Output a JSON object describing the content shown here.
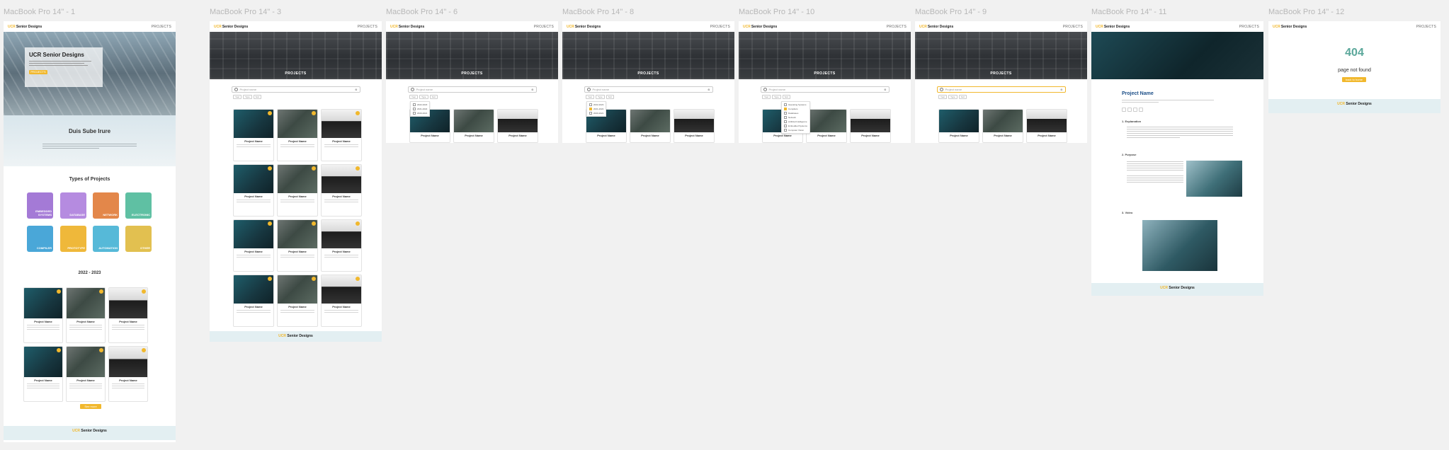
{
  "frames": [
    {
      "label": "MacBook Pro 14\" - 1"
    },
    {
      "label": "MacBook Pro 14\" - 3"
    },
    {
      "label": "MacBook Pro 14\" - 6"
    },
    {
      "label": "MacBook Pro 14\" - 8"
    },
    {
      "label": "MacBook Pro 14\" - 10"
    },
    {
      "label": "MacBook Pro 14\" - 9"
    },
    {
      "label": "MacBook Pro 14\" - 11"
    },
    {
      "label": "MacBook Pro 14\" - 12"
    }
  ],
  "nav": {
    "logo_ucr": "UCR",
    "logo_rest": "Senior Designs",
    "link": "PROJECTS"
  },
  "home": {
    "hero_title": "UCR Senior Designs",
    "hero_button": "PROJECTS",
    "about_title": "Duis Sube Irure",
    "types_title": "Types of Projects",
    "types": [
      "EMBEDDED SYSTEMS",
      "DATABASE",
      "NETWORK",
      "ELECTRONIC",
      "COMPILER",
      "PROTOTYPE",
      "AUTOMATION",
      "OTHER"
    ],
    "year_title": "2022 - 2023",
    "see_more": "See more"
  },
  "projects_page": {
    "hero_title": "PROJECTS",
    "search_placeholder": "Project name",
    "filter_year": "Year",
    "filter_type": "Type",
    "filter_sort": "Sort"
  },
  "card": {
    "name": "Project Name"
  },
  "year_options": [
    "2022-2023",
    "2021-2022",
    "2020-2021"
  ],
  "type_options": [
    "Operating Systems",
    "Compilers",
    "Databases",
    "Network",
    "Artificial Intelligence",
    "Embedded Systems",
    "Computer Vision"
  ],
  "detail": {
    "title": "Project Name",
    "section_1": "1. Explanation",
    "section_2": "2. Purpose",
    "section_3": "3. Video"
  },
  "not_found": {
    "code": "404",
    "message": "page not found",
    "button": "back to home"
  },
  "footer": {
    "logo_ucr": "UCR",
    "logo_rest": "Senior Designs"
  },
  "colors": {
    "accent": "#f1b82d",
    "footer_bg": "#e3eff2",
    "canvas": "#f1f1f1"
  }
}
